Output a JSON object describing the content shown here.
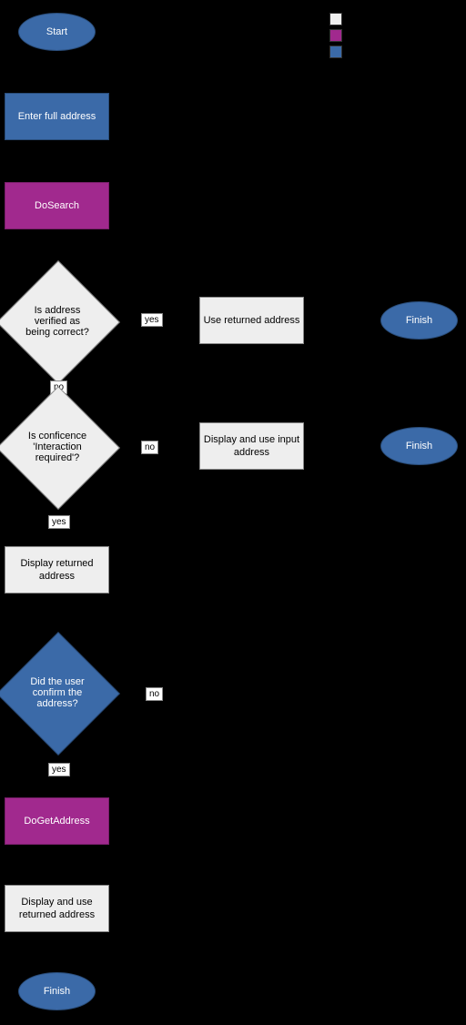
{
  "colors": {
    "blue": "#3b6aa8",
    "purple": "#a1298e",
    "grey": "#eeeeee",
    "border": "#555555"
  },
  "legend": {
    "items": [
      "grey",
      "purple",
      "blue"
    ]
  },
  "nodes": {
    "start": "Start",
    "enter_address": "Enter full address",
    "dosearch": "DoSearch",
    "verified": "Is address verified as being correct?",
    "use_returned": "Use returned address",
    "finish1": "Finish",
    "confidence": "Is conficence 'Interaction required'?",
    "display_input": "Display and use input address",
    "finish2": "Finish",
    "display_returned": "Display returned address",
    "confirm": "Did the user confirm the address?",
    "dogetaddress": "DoGetAddress",
    "display_use_returned": "Display and use returned address",
    "finish3": "Finish"
  },
  "labels": {
    "yes": "yes",
    "no": "no"
  }
}
